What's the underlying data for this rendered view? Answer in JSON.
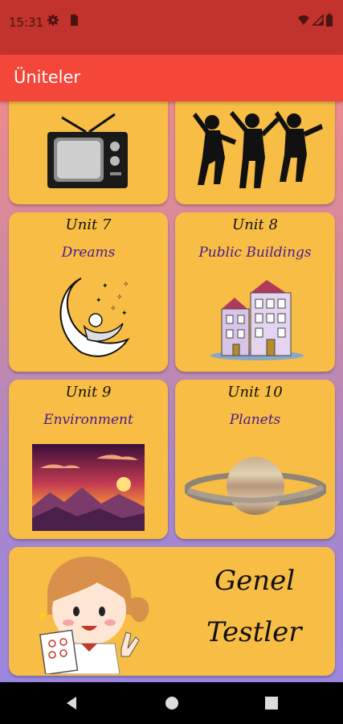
{
  "status_bar": {
    "time": "15:31",
    "icons": [
      "gear-icon",
      "sim-card-icon",
      "wifi-icon",
      "signal-icon",
      "battery-icon"
    ]
  },
  "app_bar": {
    "title": "Üniteler"
  },
  "units": [
    {
      "unit": "",
      "title": "",
      "illustration": "tv-icon"
    },
    {
      "unit": "",
      "title": "",
      "illustration": "jumping-people-icon"
    },
    {
      "unit": "Unit 7",
      "title": "Dreams",
      "illustration": "moon-dreamer-icon"
    },
    {
      "unit": "Unit 8",
      "title": "Public Buildings",
      "illustration": "building-icon"
    },
    {
      "unit": "Unit 9",
      "title": "Environment",
      "illustration": "sunset-landscape-icon"
    },
    {
      "unit": "Unit 10",
      "title": "Planets",
      "illustration": "saturn-icon"
    }
  ],
  "general_tests": {
    "line1": "Genel",
    "line2": "Testler",
    "illustration": "girl-with-test-icon"
  },
  "nav": [
    "back-icon",
    "home-icon",
    "recents-icon"
  ],
  "colors": {
    "status_bar": "#c1332c",
    "app_bar": "#f4473a",
    "card": "#f7bd45",
    "title_text": "#4b1a8c"
  }
}
